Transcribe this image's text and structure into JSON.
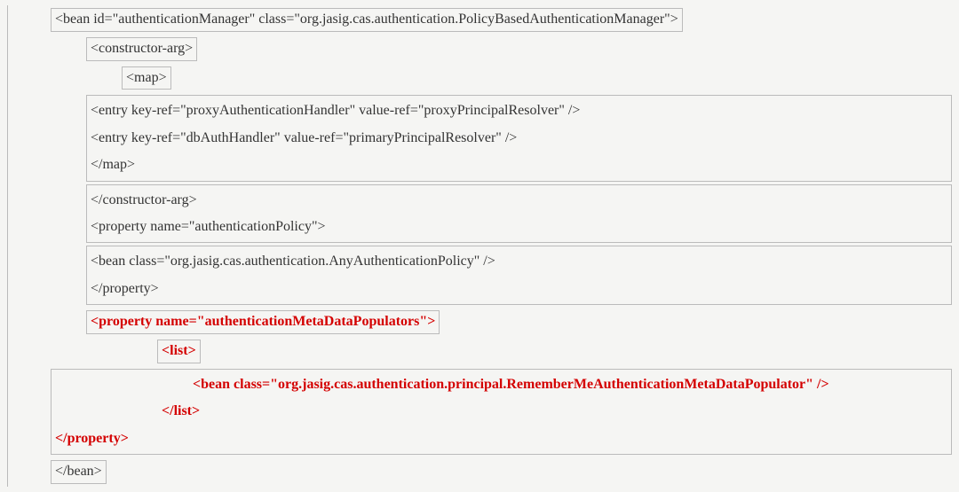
{
  "xml": {
    "bean_open": "<bean id=\"authenticationManager\" class=\"org.jasig.cas.authentication.PolicyBasedAuthenticationManager\">",
    "ctor_open": "<constructor-arg>",
    "map_open": "<map>",
    "entry1": "<entry key-ref=\"proxyAuthenticationHandler\" value-ref=\"proxyPrincipalResolver\" />",
    "entry2": "<entry key-ref=\"dbAuthHandler\" value-ref=\"primaryPrincipalResolver\" />",
    "map_close": "</map>",
    "ctor_close": "</constructor-arg>",
    "prop_authpolicy_open": "<property name=\"authenticationPolicy\">",
    "anyauth_bean": "<bean class=\"org.jasig.cas.authentication.AnyAuthenticationPolicy\" />",
    "prop_close": "</property>",
    "prop_metadata_open": "<property name=\"authenticationMetaDataPopulators\">",
    "list_open": "<list>",
    "rememberme_bean": "<bean class=\"org.jasig.cas.authentication.principal.RememberMeAuthenticationMetaDataPopulator\" />",
    "list_close": "</list>",
    "prop_metadata_close": "</property>",
    "bean_close": "</bean>"
  }
}
